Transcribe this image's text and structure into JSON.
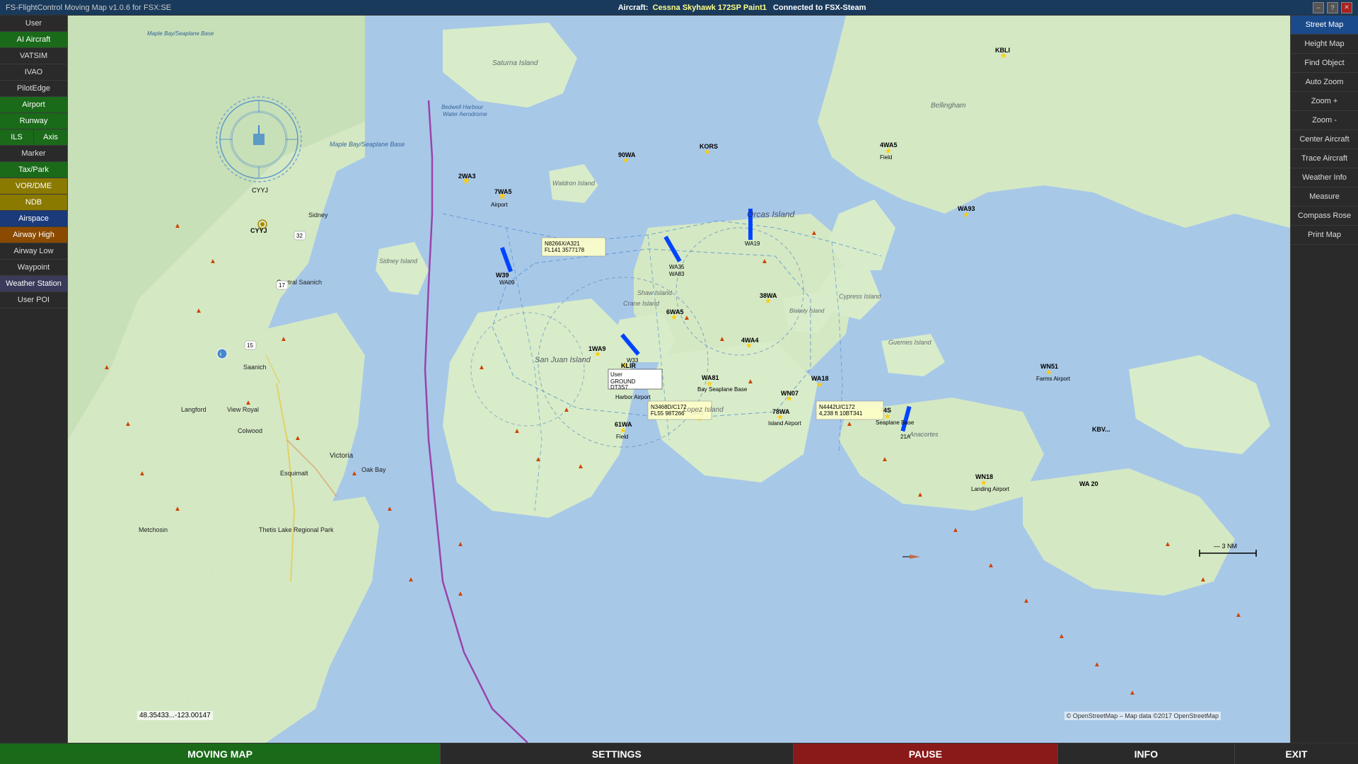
{
  "titlebar": {
    "title": "FS-FlightControl Moving Map v1.0.6 for FSX:SE",
    "aircraft_label": "Aircraft:",
    "aircraft_name": "Cessna Skyhawk 172SP Paint1",
    "connection": "Connected to FSX-Steam",
    "min_label": "−",
    "help_label": "?",
    "close_label": "✕"
  },
  "left_panel": {
    "user_label": "User",
    "ai_aircraft_label": "AI Aircraft",
    "vatsim_label": "VATSIM",
    "ivao_label": "IVAO",
    "pilotedge_label": "PilotEdge",
    "airport_label": "Airport",
    "runway_label": "Runway",
    "ils_label": "ILS",
    "axis_label": "Axis",
    "marker_label": "Marker",
    "taxipark_label": "Tax/Park",
    "vordme_label": "VOR/DME",
    "ndb_label": "NDB",
    "airspace_label": "Airspace",
    "airway_high_label": "Airway High",
    "airway_low_label": "Airway Low",
    "waypoint_label": "Waypoint",
    "weather_station_label": "Weather Station",
    "user_poi_label": "User POI"
  },
  "right_panel": {
    "street_map_label": "Street Map",
    "height_map_label": "Height Map",
    "find_object_label": "Find Object",
    "auto_zoom_label": "Auto Zoom",
    "zoom_plus_label": "Zoom +",
    "zoom_minus_label": "Zoom -",
    "center_aircraft_label": "Center Aircraft",
    "trace_aircraft_label": "Trace Aircraft",
    "weather_info_label": "Weather Info",
    "measure_label": "Measure",
    "compass_rose_label": "Compass Rose",
    "print_map_label": "Print Map"
  },
  "bottom_bar": {
    "moving_map_label": "MOVING MAP",
    "settings_label": "SETTINGS",
    "pause_label": "PAUSE",
    "info_label": "INFO",
    "exit_label": "EXIT"
  },
  "coords": "48.35433...-123.00147",
  "copyright": "© OpenStreetMap – Map data ©2017 OpenStreetMap"
}
